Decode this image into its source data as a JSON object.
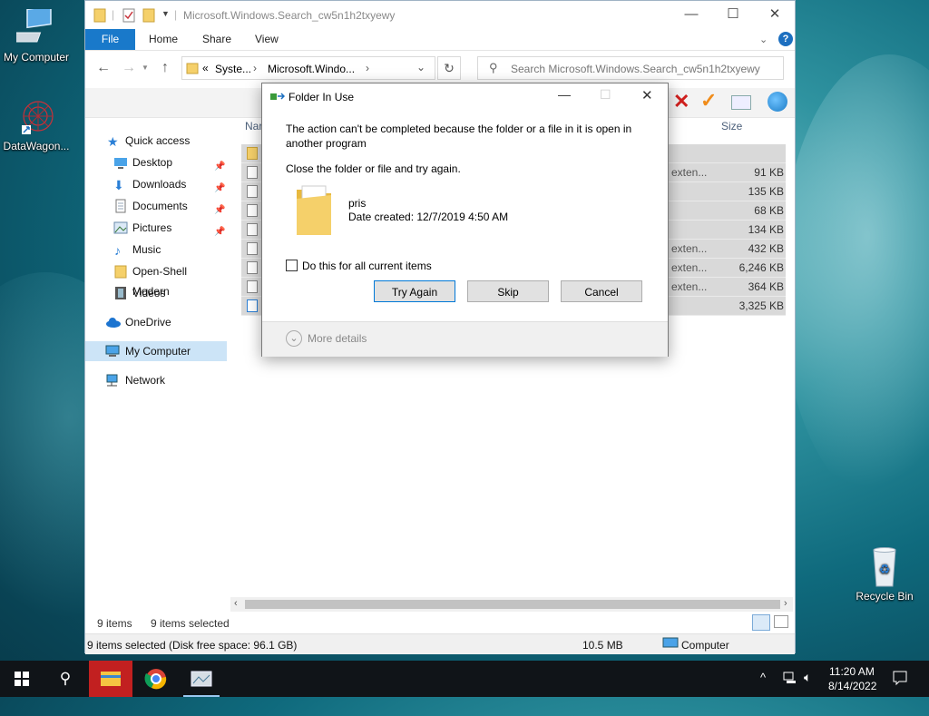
{
  "desktop": {
    "icons": [
      {
        "label": "My Computer"
      },
      {
        "label": "DataWagon..."
      },
      {
        "label": "Recycle Bin"
      }
    ]
  },
  "explorer": {
    "title": "Microsoft.Windows.Search_cw5n1h2txyewy",
    "ribbon_tabs": [
      "File",
      "Home",
      "Share",
      "View"
    ],
    "breadcrumb": {
      "prefix": "«",
      "segments": [
        "Syste...",
        "Microsoft.Windo..."
      ]
    },
    "search_placeholder": "Search Microsoft.Windows.Search_cw5n1h2txyewy",
    "columns": {
      "name": "Nar",
      "size": "Size"
    },
    "nav": {
      "quick_access": "Quick access",
      "items": [
        "Desktop",
        "Downloads",
        "Documents",
        "Pictures",
        "Music",
        "Open-Shell Modern",
        "Videos"
      ],
      "onedrive": "OneDrive",
      "my_computer": "My Computer",
      "network": "Network"
    },
    "files": [
      {
        "type": "",
        "size": ""
      },
      {
        "type": "exten...",
        "size": "91 KB"
      },
      {
        "type": "",
        "size": "135 KB"
      },
      {
        "type": "",
        "size": "68 KB"
      },
      {
        "type": "",
        "size": "134 KB"
      },
      {
        "type": "exten...",
        "size": "432 KB"
      },
      {
        "type": "exten...",
        "size": "6,246 KB"
      },
      {
        "type": "exten...",
        "size": "364 KB"
      },
      {
        "type": "",
        "size": "3,325 KB"
      }
    ],
    "status": {
      "item_count": "9 items",
      "selected": "9 items selected",
      "disk_info": "9 items selected (Disk free space: 96.1 GB)",
      "total_size": "10.5 MB",
      "location": "Computer"
    }
  },
  "dialog": {
    "title": "Folder In Use",
    "message": "The action can't be completed because the folder or a file in it is open in another program",
    "instruction": "Close the folder or file and try again.",
    "item_name": "pris",
    "date_created": "Date created: 12/7/2019 4:50 AM",
    "checkbox_label": "Do this for all current items",
    "buttons": {
      "try_again": "Try Again",
      "skip": "Skip",
      "cancel": "Cancel"
    },
    "more_details": "More details"
  },
  "taskbar": {
    "time": "11:20 AM",
    "date": "8/14/2022"
  },
  "colors": {
    "accent": "#1979ca",
    "selection": "#cce4f7",
    "folder": "#f5d06a"
  }
}
